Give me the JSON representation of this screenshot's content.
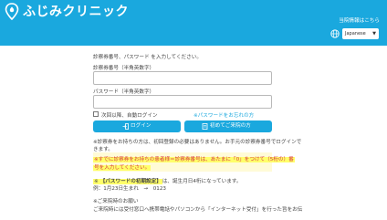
{
  "header": {
    "logo_text": "ふじみクリニック",
    "hospital_link": "当院情報はこちら",
    "language_selected": "Japanese",
    "language_arrow": "▼",
    "colors": {
      "brand": "#1aa8de",
      "highlight": "#ffff6a",
      "red": "#d7343f"
    }
  },
  "form": {
    "intro": "診察券番号、パスワード を入力してください。",
    "card_number_label": "診察券番号（半角英数字）",
    "card_number_value": "",
    "password_label": "パスワード（半角英数字）",
    "password_value": "",
    "next_login_label": "次回以降、自動ログイン",
    "forgot_password_link": "※パスワードをお忘れの方",
    "login_button": "ログイン",
    "first_time_button": "初めてご来院の方"
  },
  "notes": {
    "line1": "※診察券をお持ちの方は、初回登録の必要はありません。お手元の診察券番号でログインで",
    "line2": "きます。",
    "line3": "※すでに診察券をお持ちの患者様＝診察券番号は、あたまに「0」をつけて（5桁の）番",
    "line4": "号を入力してください。",
    "pw_prefix": "※",
    "pw_title": "【パスワードの初期設定】",
    "pw_text": "は、誕生月日4桁になっています。",
    "pw_example": "例：1月23日生まれ　→　0123",
    "bottom1": "※ご来院時のお願い",
    "bottom2": "ご来院時には受付窓口へ携帯電話やパソコンから「インターネット受付」を行った旨をお伝"
  }
}
